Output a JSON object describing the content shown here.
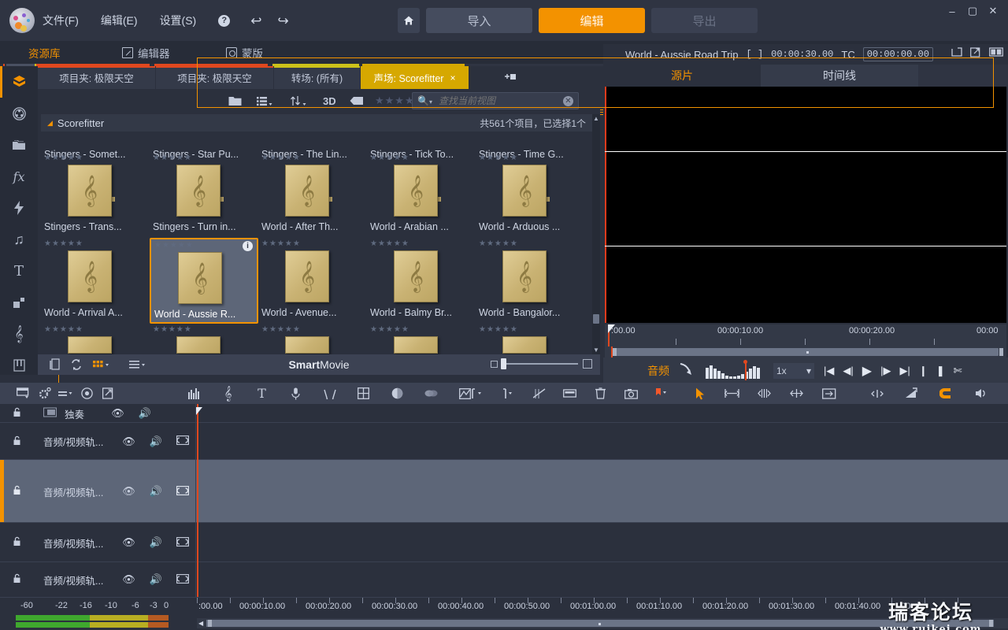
{
  "window": {
    "minimize": "–",
    "maximize": "▢",
    "close": "✕"
  },
  "menubar": {
    "items": [
      {
        "label": "文件(F)",
        "name": "menu-file"
      },
      {
        "label": "编辑(E)",
        "name": "menu-edit"
      },
      {
        "label": "设置(S)",
        "name": "menu-settings"
      }
    ],
    "help_icon": "?",
    "undo_icon": "↩",
    "redo_icon": "↪"
  },
  "topnav": {
    "home_icon": "⌂",
    "buttons": [
      {
        "label": "导入",
        "state": "normal"
      },
      {
        "label": "编辑",
        "state": "active"
      },
      {
        "label": "导出",
        "state": "disabled"
      }
    ]
  },
  "modetabs": [
    {
      "label": "资源库",
      "icon": "library-icon",
      "active": true
    },
    {
      "label": "编辑器",
      "icon": "editor-icon",
      "active": false
    },
    {
      "label": "蒙版",
      "icon": "mask-icon",
      "active": false
    }
  ],
  "rail": {
    "items": [
      {
        "name": "project-icon",
        "glyph": "✾"
      },
      {
        "name": "film-reel-icon",
        "glyph": "◉"
      },
      {
        "name": "folders-icon",
        "glyph": "❐"
      },
      {
        "name": "effects-icon",
        "glyph": "fx"
      },
      {
        "name": "transitions-icon",
        "glyph": "⚡"
      },
      {
        "name": "audio-icon",
        "glyph": "♫"
      },
      {
        "name": "title-icon",
        "glyph": "T"
      },
      {
        "name": "overlay-icon",
        "glyph": "▰"
      },
      {
        "name": "scorefitter-icon",
        "glyph": "𝄞"
      },
      {
        "name": "piano-icon",
        "glyph": "▥"
      }
    ]
  },
  "library": {
    "tabs": [
      {
        "label": "项目夹: 极限天空",
        "accent": "#e0481f",
        "selected": false
      },
      {
        "label": "项目夹: 极限天空",
        "accent": "#e0481f",
        "selected": false
      },
      {
        "label": "转场: (所有)",
        "accent": "#cdc21a",
        "selected": false
      },
      {
        "label": "声场: Scorefitter",
        "accent": "#d6a800",
        "selected": true,
        "close": "×"
      }
    ],
    "add_tab_icon": "add-tab-icon",
    "toolbar": {
      "folder_icon": "📁",
      "list_icon": "☰",
      "sort_icon": "↑↓",
      "threed_label": "3D",
      "tag_icon": "🏷",
      "rating": "★★★★★",
      "search_placeholder": "查找当前视图",
      "search_value": "",
      "search_icon": "search-icon",
      "clear_icon": "✕"
    },
    "header": {
      "caret": "◢",
      "title": "Scorefitter",
      "count_text": "共561个项目，已选择1个"
    },
    "items": [
      {
        "name": "Stingers - Somet...",
        "stars": "★★★★★",
        "selected": false
      },
      {
        "name": "Stingers - Star Pu...",
        "stars": "★★★★★",
        "selected": false
      },
      {
        "name": "Stingers - The Lin...",
        "stars": "★★★★★",
        "selected": false
      },
      {
        "name": "Stingers - Tick To...",
        "stars": "★★★★★",
        "selected": false
      },
      {
        "name": "Stingers - Time G...",
        "stars": "★★★★★",
        "selected": false
      },
      {
        "name": "Stingers - Trans...",
        "stars": "★★★★★",
        "selected": false
      },
      {
        "name": "Stingers - Turn in...",
        "stars": "★★★★★",
        "selected": false
      },
      {
        "name": "World - After Th...",
        "stars": "★★★★★",
        "selected": false
      },
      {
        "name": "World - Arabian ...",
        "stars": "★★★★★",
        "selected": false
      },
      {
        "name": "World - Arduous ...",
        "stars": "★★★★★",
        "selected": false
      },
      {
        "name": "World - Arrival A...",
        "stars": "★★★★★",
        "selected": false
      },
      {
        "name": "World - Aussie R...",
        "stars": "★★★★★",
        "selected": true,
        "info": "i"
      },
      {
        "name": "World - Avenue...",
        "stars": "★★★★★",
        "selected": false
      },
      {
        "name": "World - Balmy Br...",
        "stars": "★★★★★",
        "selected": false
      },
      {
        "name": "World - Bangalor...",
        "stars": "★★★★★",
        "selected": false
      }
    ],
    "footer": {
      "copy_icon": "copy-icon",
      "sync_icon": "sync-icon",
      "grid_icon": "grid-icon",
      "list_icon": "list-icon",
      "title_bold": "Smart",
      "title_rest": "Movie"
    }
  },
  "preview": {
    "clip_title": "World - Aussie Road Trip",
    "duration_label": "[ ]",
    "duration": "00:00:30.00",
    "tc_label": "TC",
    "tc_value": "00:00:00.00",
    "header_icons": [
      "popout-icon",
      "fullscreen-icon",
      "split-view-icon"
    ],
    "tabs": [
      {
        "label": "源片",
        "active": true
      },
      {
        "label": "时间线",
        "active": false
      }
    ],
    "ruler_labels": [
      ":00.00",
      "00:00:10.00",
      "00:00:20.00",
      "00:00"
    ],
    "transport": {
      "audio_label": "音频",
      "curve_icon": "audio-curve-icon",
      "waveform_icon": "waveform-icon",
      "speed": "1x",
      "speed_caret": "▾",
      "buttons": [
        {
          "name": "go-to-start-button",
          "glyph": "|◀"
        },
        {
          "name": "step-back-button",
          "glyph": "◀|"
        },
        {
          "name": "play-button",
          "glyph": "▶"
        },
        {
          "name": "step-forward-button",
          "glyph": "|▶"
        },
        {
          "name": "go-to-end-button",
          "glyph": "▶|"
        },
        {
          "name": "mark-in-button",
          "glyph": "❙"
        },
        {
          "name": "mark-out-button",
          "glyph": "❚"
        },
        {
          "name": "clear-marks-button",
          "glyph": "✄"
        }
      ]
    }
  },
  "timeline_toolbar": {
    "left_group": [
      {
        "name": "track-manager-icon",
        "glyph": "▤"
      },
      {
        "name": "settings-gear-icon",
        "glyph": "⚙"
      },
      {
        "name": "marker-icon",
        "glyph": "▬"
      },
      {
        "name": "disc-icon",
        "glyph": "◎"
      },
      {
        "name": "expand-icon",
        "glyph": "⤢"
      }
    ],
    "mid_group": [
      {
        "name": "audio-mixer-icon",
        "glyph": "𝄃𝄃"
      },
      {
        "name": "music-note-icon",
        "glyph": "𝄞"
      },
      {
        "name": "title-icon",
        "glyph": "T"
      },
      {
        "name": "voiceover-icon",
        "glyph": "🎤"
      },
      {
        "name": "curve-icon",
        "glyph": "∨"
      },
      {
        "name": "grid-icon",
        "glyph": "⊞"
      },
      {
        "name": "color-icon",
        "glyph": "◕"
      },
      {
        "name": "blend-icon",
        "glyph": "◍"
      },
      {
        "name": "keyframe-icon",
        "glyph": "◪"
      }
    ],
    "mark_group": [
      {
        "name": "mark-in-icon",
        "glyph": "❙"
      },
      {
        "name": "mark-out-icon",
        "glyph": "❚"
      },
      {
        "name": "clear-marks-icon",
        "glyph": "✄"
      },
      {
        "name": "split-icon",
        "glyph": "▭"
      },
      {
        "name": "delete-icon",
        "glyph": "🗑"
      },
      {
        "name": "snapshot-icon",
        "glyph": "📷"
      },
      {
        "name": "marker-flag-icon",
        "glyph": "⚑"
      }
    ],
    "tools_group": [
      {
        "name": "select-tool-icon",
        "glyph": "➤"
      },
      {
        "name": "trim-both-icon",
        "glyph": "↔"
      },
      {
        "name": "roll-edit-icon",
        "glyph": "⇹"
      },
      {
        "name": "slip-edit-icon",
        "glyph": "⇿"
      },
      {
        "name": "fit-icon",
        "glyph": "⊡"
      }
    ],
    "right_group": [
      {
        "name": "center-icon",
        "glyph": "⇥⇤"
      },
      {
        "name": "ramp-icon",
        "glyph": "◸"
      },
      {
        "name": "magnet-icon",
        "glyph": "⊂"
      },
      {
        "name": "audio-scrub-icon",
        "glyph": "🔊"
      },
      {
        "name": "magic-wand-icon",
        "glyph": "✨"
      }
    ]
  },
  "timeline": {
    "tracks": [
      {
        "label": "独奏",
        "height": 24,
        "selected": false,
        "has_solo_icon": true,
        "has_extra": false
      },
      {
        "label": "音频/视频轨...",
        "height": 46,
        "selected": false,
        "has_solo_icon": false,
        "has_extra": true
      },
      {
        "label": "音频/视频轨...",
        "height": 80,
        "selected": true,
        "has_solo_icon": false,
        "has_extra": true
      },
      {
        "label": "音频/视频轨...",
        "height": 50,
        "selected": false,
        "has_solo_icon": false,
        "has_extra": true
      },
      {
        "label": "音频/视频轨...",
        "height": 45,
        "selected": false,
        "has_solo_icon": false,
        "has_extra": true
      }
    ],
    "track_icons": {
      "lock": "lock-icon",
      "eye": "eye-icon",
      "speaker": "speaker-icon",
      "extra": "transparency-icon"
    },
    "ruler_labels": [
      ":00.00",
      "00:00:10.00",
      "00:00:20.00",
      "00:00:30.00",
      "00:00:40.00",
      "00:00:50.00",
      "00:01:00.00",
      "00:01:10.00",
      "00:01:20.00",
      "00:01:30.00",
      "00:01:40.00",
      "00"
    ]
  },
  "audio_meter": {
    "scale": [
      "-60",
      "-22",
      "-16",
      "-10",
      "-6",
      "-3",
      "0"
    ],
    "colors": {
      "green": "#3fa82e",
      "yellow": "#b8ae22",
      "red": "#b55a22"
    }
  },
  "watermark": {
    "line1": "瑞客论坛",
    "line2": "www.ruikei.com"
  },
  "colors": {
    "accent": "#f39200",
    "tab_selected": "#d6a800",
    "panel": "#2b303d",
    "panel_light": "#3c4253",
    "playhead": "#e0481f"
  }
}
